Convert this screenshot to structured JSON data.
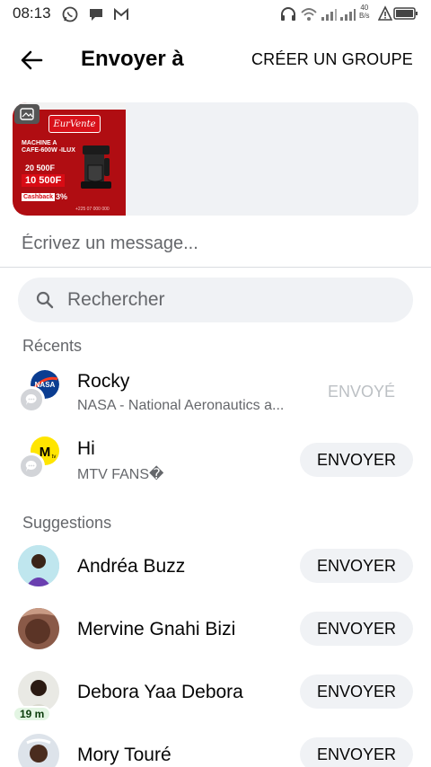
{
  "status_bar": {
    "time": "08:13",
    "net_speed_top": "40",
    "net_speed_bottom": "B/s",
    "icons": [
      "whatsapp-icon",
      "chat-bubble-icon",
      "gmail-icon",
      "headphones-icon",
      "wifi-icon",
      "signal-icon",
      "signal-icon",
      "alert-icon",
      "battery-icon"
    ]
  },
  "header": {
    "back_icon": "arrow-left-icon",
    "title": "Envoyer à",
    "create_group_label": "CRÉER UN GROUPE"
  },
  "preview": {
    "ad_brand": "EurVente",
    "ad_headline": "MACHINE A CAFE-600W -ILUX",
    "ad_old_price": "20 500F",
    "ad_new_price": "10 500F",
    "ad_cashback_label": "Cashback",
    "ad_cashback_value": "3%",
    "ad_footer": "+225 07 000 000"
  },
  "message": {
    "placeholder": "Écrivez un message..."
  },
  "search": {
    "placeholder": "Rechercher"
  },
  "sections": {
    "recents_label": "Récents",
    "suggestions_label": "Suggestions"
  },
  "recents": [
    {
      "name": "Rocky",
      "subtitle": "NASA - National Aeronautics a...",
      "action": "ENVOYÉ",
      "sent": true
    },
    {
      "name": "Hi",
      "subtitle": "MTV FANS�",
      "action": "ENVOYER",
      "sent": false
    }
  ],
  "suggestions": [
    {
      "name": "Andréa Buzz",
      "action": "ENVOYER"
    },
    {
      "name": "Mervine Gnahi Bizi",
      "action": "ENVOYER"
    },
    {
      "name": "Debora Yaa Debora",
      "action": "ENVOYER",
      "badge": "19 m"
    },
    {
      "name": "Mory Touré",
      "action": "ENVOYER"
    }
  ],
  "colors": {
    "text_primary": "#050505",
    "text_secondary": "#65676b",
    "button_bg": "#f0f2f5",
    "sent_text": "#bcc0c4",
    "active_badge": "#e3f5e3"
  }
}
